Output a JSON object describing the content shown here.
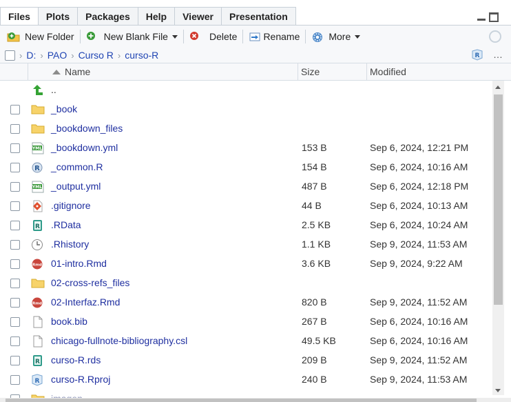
{
  "tabs": [
    "Files",
    "Plots",
    "Packages",
    "Help",
    "Viewer",
    "Presentation"
  ],
  "toolbar": {
    "new_folder": "New Folder",
    "new_blank_file": "New Blank File",
    "delete": "Delete",
    "rename": "Rename",
    "more": "More"
  },
  "breadcrumb": [
    "D:",
    "PAO",
    "Curso R",
    "curso-R"
  ],
  "header": {
    "name": "Name",
    "size": "Size",
    "modified": "Modified"
  },
  "files": [
    {
      "name": "..",
      "size": "",
      "modified": "",
      "icon": "up-arrow-icon"
    },
    {
      "name": "_book",
      "size": "",
      "modified": "",
      "icon": "folder-icon"
    },
    {
      "name": "_bookdown_files",
      "size": "",
      "modified": "",
      "icon": "folder-icon"
    },
    {
      "name": "_bookdown.yml",
      "size": "153 B",
      "modified": "Sep 6, 2024, 12:21 PM",
      "icon": "yaml-file-icon"
    },
    {
      "name": "_common.R",
      "size": "154 B",
      "modified": "Sep 6, 2024, 10:16 AM",
      "icon": "r-script-icon"
    },
    {
      "name": "_output.yml",
      "size": "487 B",
      "modified": "Sep 6, 2024, 12:18 PM",
      "icon": "yaml-file-icon"
    },
    {
      "name": ".gitignore",
      "size": "44 B",
      "modified": "Sep 6, 2024, 10:13 AM",
      "icon": "git-file-icon"
    },
    {
      "name": ".RData",
      "size": "2.5 KB",
      "modified": "Sep 6, 2024, 10:24 AM",
      "icon": "rdata-file-icon"
    },
    {
      "name": ".Rhistory",
      "size": "1.1 KB",
      "modified": "Sep 9, 2024, 11:53 AM",
      "icon": "history-file-icon"
    },
    {
      "name": "01-intro.Rmd",
      "size": "3.6 KB",
      "modified": "Sep 9, 2024, 9:22 AM",
      "icon": "rmd-file-icon"
    },
    {
      "name": "02-cross-refs_files",
      "size": "",
      "modified": "",
      "icon": "folder-icon"
    },
    {
      "name": "02-Interfaz.Rmd",
      "size": "820 B",
      "modified": "Sep 9, 2024, 11:52 AM",
      "icon": "rmd-file-icon"
    },
    {
      "name": "book.bib",
      "size": "267 B",
      "modified": "Sep 6, 2024, 10:16 AM",
      "icon": "blank-file-icon"
    },
    {
      "name": "chicago-fullnote-bibliography.csl",
      "size": "49.5 KB",
      "modified": "Sep 6, 2024, 10:16 AM",
      "icon": "blank-file-icon"
    },
    {
      "name": "curso-R.rds",
      "size": "209 B",
      "modified": "Sep 9, 2024, 11:52 AM",
      "icon": "rdata-file-icon"
    },
    {
      "name": "curso-R.Rproj",
      "size": "240 B",
      "modified": "Sep 9, 2024, 11:53 AM",
      "icon": "rproj-file-icon"
    },
    {
      "name": "imagen",
      "size": "",
      "modified": "",
      "icon": "folder-icon"
    }
  ]
}
